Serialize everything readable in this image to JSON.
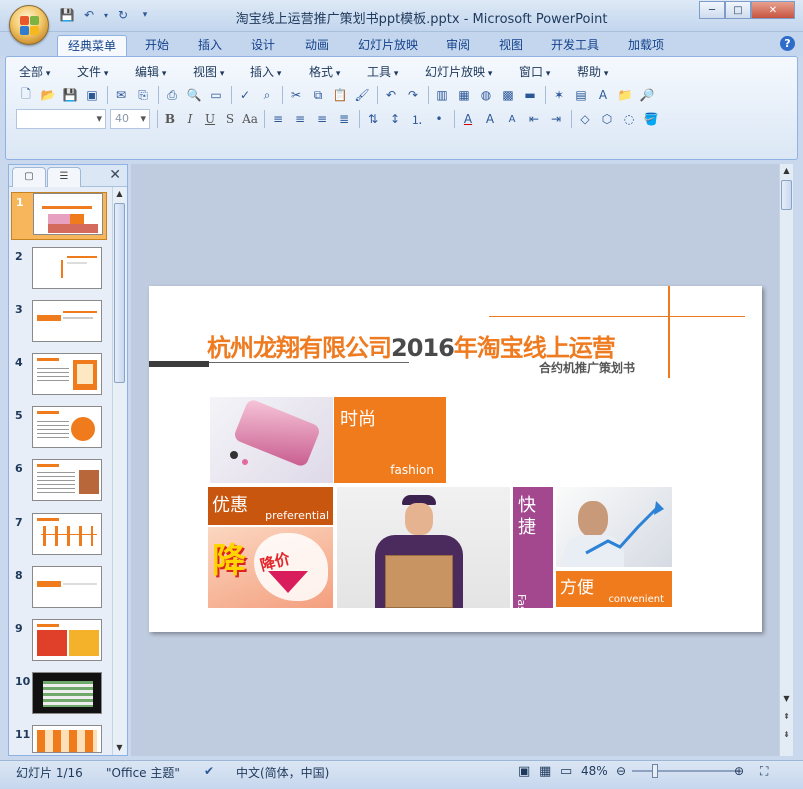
{
  "window": {
    "title": "淘宝线上运营推广策划书ppt模板.pptx - Microsoft PowerPoint"
  },
  "tabs": [
    "经典菜单",
    "开始",
    "插入",
    "设计",
    "动画",
    "幻灯片放映",
    "审阅",
    "视图",
    "开发工具",
    "加载项"
  ],
  "active_tab": "经典菜单",
  "menu": [
    "全部",
    "文件",
    "编辑",
    "视图",
    "插入",
    "格式",
    "工具",
    "幻灯片放映",
    "窗口",
    "帮助"
  ],
  "font_size": "40",
  "font_name": "",
  "thumbnails": [
    "1",
    "2",
    "3",
    "4",
    "5",
    "6",
    "7",
    "8",
    "9",
    "10",
    "11"
  ],
  "selected_slide": "1",
  "slide": {
    "company": "杭州龙翔有限公司",
    "year": "2016",
    "title_rest": "年淘宝线上运营",
    "subtitle": "合约机推广策划书",
    "tile_fashion_cn": "时尚",
    "tile_fashion_en": "fashion",
    "tile_pref_cn": "优惠",
    "tile_pref_en": "preferential",
    "tile_fast_cn_1": "快",
    "tile_fast_cn_2": "捷",
    "tile_fast_en": "Fast",
    "tile_conv_cn": "方便",
    "tile_conv_en": "convenient",
    "promo_big": "降",
    "promo_small": "降价"
  },
  "status": {
    "slide_info": "幻灯片 1/16",
    "theme": "\"Office 主题\"",
    "language": "中文(简体，中国)",
    "zoom": "48%"
  },
  "colors": {
    "accent": "#f07b1c",
    "purple": "#a3478f",
    "dark_orange": "#c8560f"
  }
}
